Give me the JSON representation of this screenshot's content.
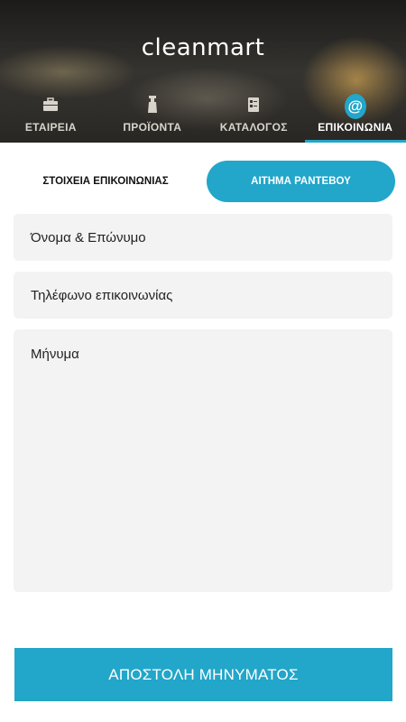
{
  "app": {
    "logo": "cleanmart"
  },
  "tabs": [
    {
      "label": "ΕΤΑΙΡΕΙΑ",
      "icon": "briefcase-icon",
      "active": false
    },
    {
      "label": "ΠΡΟΪΟΝΤΑ",
      "icon": "spray-bottle-icon",
      "active": false
    },
    {
      "label": "ΚΑΤΑΛΟΓΟΣ",
      "icon": "catalog-icon",
      "active": false
    },
    {
      "label": "ΕΠΙΚΟΙΝΩΝΙΑ",
      "icon": "at-sign-icon",
      "icon_text": "@",
      "active": true
    }
  ],
  "segment": {
    "left_label": "ΣΤΟΙΧΕΙΑ ΕΠΙΚΟΙΝΩΝΙΑΣ",
    "right_label": "ΑΙΤΗΜΑ ΡΑΝΤΕΒΟΥ",
    "selected": "right"
  },
  "form": {
    "name_placeholder": "Όνομα & Επώνυμο",
    "phone_placeholder": "Τηλέφωνο επικοινωνίας",
    "message_placeholder": "Μήνυμα"
  },
  "submit_label": "ΑΠΟΣΤΟΛΗ ΜΗΝΥΜΑΤΟΣ",
  "colors": {
    "accent": "#22a6c9",
    "field_bg": "#f3f3f3"
  }
}
